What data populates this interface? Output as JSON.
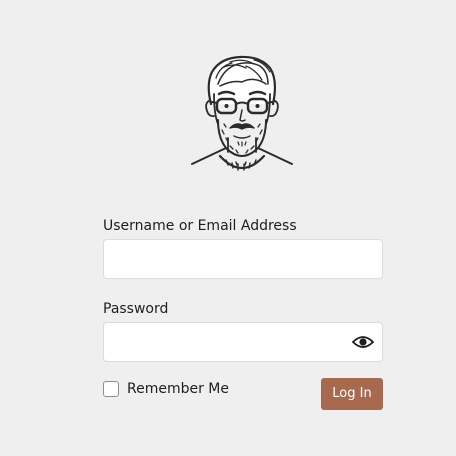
{
  "logo": {
    "icon": "bearded-man-avatar-icon"
  },
  "form": {
    "username_label": "Username or Email Address",
    "username_value": "",
    "password_label": "Password",
    "password_value": "",
    "show_password_icon": "eye-icon",
    "remember_label": "Remember Me",
    "remember_checked": false,
    "login_label": "Log In"
  },
  "colors": {
    "background": "#efefef",
    "button": "#a86a4e",
    "button_text": "#ffffff",
    "input_border": "#dcdcde"
  }
}
